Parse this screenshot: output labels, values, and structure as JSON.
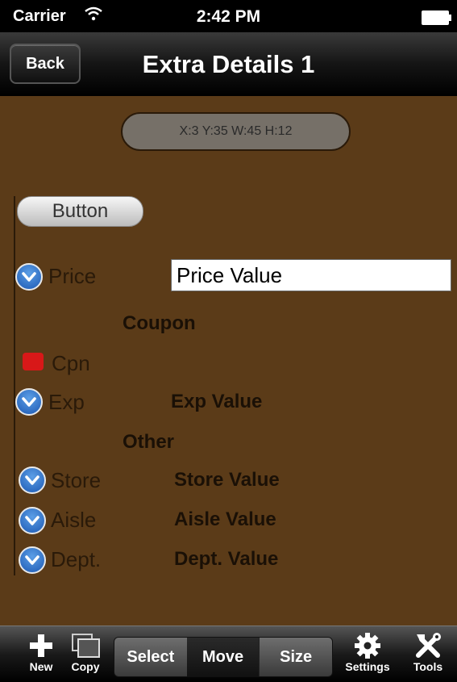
{
  "status_bar": {
    "carrier": "Carrier",
    "time": "2:42 PM"
  },
  "nav": {
    "back_label": "Back",
    "title": "Extra Details 1"
  },
  "coords": "X:3 Y:35 W:45 H:12",
  "button_label": "Button",
  "price": {
    "label": "Price",
    "value": "Price Value"
  },
  "sections": {
    "coupon": "Coupon",
    "other": "Other"
  },
  "cpn": {
    "label": "Cpn",
    "checked": true
  },
  "exp": {
    "label": "Exp",
    "value": "Exp Value"
  },
  "store": {
    "label": "Store",
    "value": "Store Value"
  },
  "aisle": {
    "label": "Aisle",
    "value": "Aisle Value"
  },
  "dept": {
    "label": "Dept.",
    "value": "Dept. Value"
  },
  "toolbar": {
    "new": "New",
    "copy": "Copy",
    "segments": [
      "Select",
      "Move",
      "Size"
    ],
    "selected_segment": "Move",
    "settings": "Settings",
    "tools": "Tools"
  },
  "colors": {
    "content_bg": "#5b3b18",
    "checkbox": "#d81818",
    "disclosure": "#1d59b3"
  }
}
